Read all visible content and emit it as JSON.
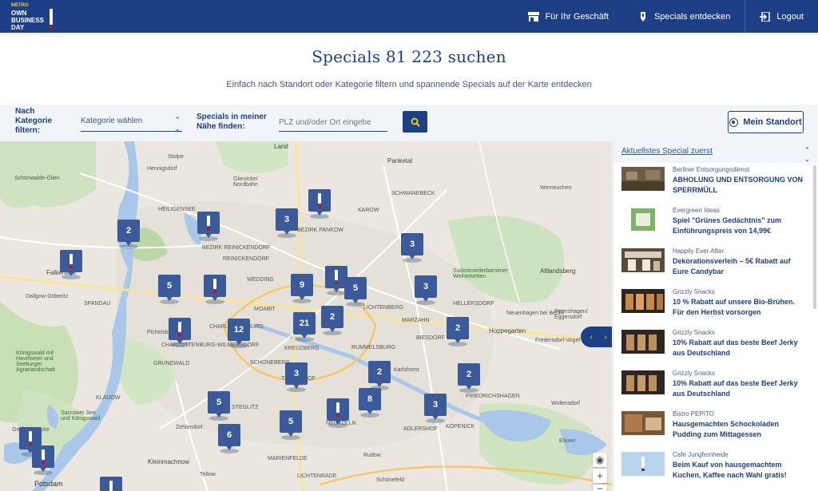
{
  "header": {
    "logo": {
      "line1": "METRO",
      "line2": "OWN",
      "line3": "BUSINESS",
      "line4": "DAY"
    },
    "nav": [
      {
        "label": "Für Ihr Geschäft",
        "icon": "store-icon"
      },
      {
        "label": "Specials entdecken",
        "icon": "exclamation-tag-icon"
      },
      {
        "label": "Logout",
        "icon": "logout-icon"
      }
    ]
  },
  "hero": {
    "title": "Specials 81 223 suchen",
    "subtitle": "Einfach nach Standort oder Kategorie filtern und spannende Specials auf der Karte entdecken"
  },
  "filters": {
    "category_label": "Nach Kategorie filtern:",
    "category_value": "Kategorie wählen",
    "nearby_label": "Specials in meiner Nähe finden:",
    "location_placeholder": "PLZ und/oder Ort eingebe",
    "my_location_label": "Mein Standort"
  },
  "map": {
    "labels": [
      "Land",
      "Stolpe",
      "Hennigsdorf",
      "Schönwalde-Glien",
      "Glienicke/ Nordbahn",
      "Panketal",
      "SCHWANEBECK",
      "Werneuchen",
      "KAROW",
      "BEZIRK PANKOW",
      "Falkensee",
      "Dallgow-Döberitz",
      "Sudostniederbarnimer Weiherketten",
      "Altlandsberg",
      "HELLERSDORF",
      "Hoppegarten",
      "Neuenhagen bei Berlin",
      "Petershagen/ Eggersdorf",
      "Fredersdorf-Vogel",
      "Pichelsberg",
      "CHARLOTTENBURG-WILMERSDORF",
      "GRUNEWALD",
      "Königswald mit Havelseen und Seeburger Agrarlandschaft",
      "KLADOW",
      "Sacrower See und Königswald",
      "Potsdam",
      "Kleinmachnow",
      "Teltow",
      "Schönefeld",
      "Erkner",
      "Wolteradorf",
      "KÖPENICK",
      "ADLERSHOF",
      "RUMMELSBURG",
      "KREUZBERG",
      "SCHÖNEBERG",
      "TEMPELHOF",
      "STEGLITZ",
      "LICHTENRADE",
      "MARIENFELDE",
      "NEUKÖLLN",
      "MARZAHN",
      "LICHTENBERG",
      "BIESDORF",
      "FRIEDRICHSHAGEN",
      "REINICKENDORF",
      "WEDDING",
      "MOABIT",
      "CHARLOTTENBURG",
      "SPANDAU",
      "BEZIRK REINICKENDORF",
      "HEILIGENSEE",
      "Karlshorst",
      "Rudow",
      "Zehlendorf",
      "Groß Glienicke"
    ],
    "markers": [
      {
        "count": "2"
      },
      {
        "count": "3"
      },
      {
        "count": "3"
      },
      {
        "count": "5"
      },
      {
        "count": "9"
      },
      {
        "count": "5"
      },
      {
        "count": "3"
      },
      {
        "count": "21"
      },
      {
        "count": "2"
      },
      {
        "count": "12"
      },
      {
        "count": "2"
      },
      {
        "count": "3"
      },
      {
        "count": "2"
      },
      {
        "count": "2"
      },
      {
        "count": "8"
      },
      {
        "count": "5"
      },
      {
        "count": "5"
      },
      {
        "count": "3"
      },
      {
        "count": "6"
      }
    ],
    "zoom_in": "+",
    "zoom_out": "−",
    "prev": "‹",
    "next": "›"
  },
  "sidebar": {
    "sort_label": "Aktuellstes Special zuerst",
    "items": [
      {
        "vendor": "Berliner Entsorgungsdienst",
        "title": "ABHOLUNG UND ENTSORGUNG VON SPERRMÜLL"
      },
      {
        "vendor": "Evergreen Ideas",
        "title": "Spiel \"Grünes Gedächtnis\" zum Einführungspreis von 14,99€"
      },
      {
        "vendor": "Happily Ever After",
        "title": "Dekorationsverleih – 5€ Rabatt auf Eure Candybar"
      },
      {
        "vendor": "Grizzly Snacks",
        "title": "10 % Rabatt auf unsere Bio-Brühen. Für den Herbst vorsorgen"
      },
      {
        "vendor": "Grizzly Snacks",
        "title": "10% Rabatt auf das beste Beef Jerky aus Deutschland"
      },
      {
        "vendor": "Grizzly Snacks",
        "title": "10% Rabatt auf das beste Beef Jerky aus Deutschland"
      },
      {
        "vendor": "Bistro PEPITO",
        "title": "Hausgemachten Schockoladen Pudding zum Mittagessen"
      },
      {
        "vendor": "Cafe Jungfernheide",
        "title": "Beim Kauf von hausgemachtem Kuchen, Kaffee nach Wahl gratis!"
      }
    ]
  }
}
